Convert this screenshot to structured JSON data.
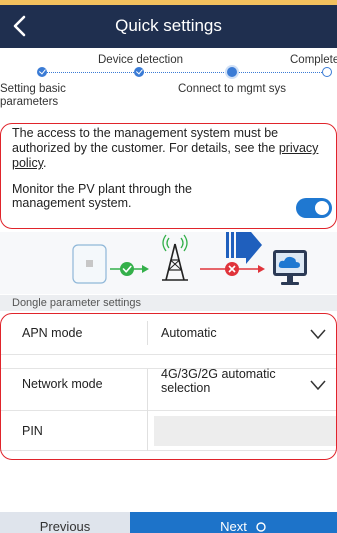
{
  "header": {
    "title": "Quick settings",
    "back_icon": "chevron-left-icon"
  },
  "stepper": {
    "steps": [
      {
        "label": "Setting basic parameters",
        "state": "done"
      },
      {
        "label": "Device detection",
        "state": "done"
      },
      {
        "label": "Connect to mgmt sys",
        "state": "current"
      },
      {
        "label": "Complete",
        "state": "pending"
      }
    ]
  },
  "consent": {
    "text": "The access to the management system must be authorized by the customer. For details, see the ",
    "link": "privacy policy",
    "suffix": "."
  },
  "monitor": {
    "label": "Monitor the PV plant through the management system.",
    "enabled": true
  },
  "diagram": {
    "icons": [
      "inverter-icon",
      "check-icon",
      "cell-tower-icon",
      "error-icon",
      "cloud-monitor-icon"
    ]
  },
  "dongle": {
    "section_title": "Dongle parameter settings",
    "apn_mode": {
      "label": "APN mode",
      "value": "Automatic"
    },
    "network_mode": {
      "label": "Network mode",
      "value": "4G/3G/2G automatic selection"
    },
    "pin": {
      "label": "PIN",
      "value": ""
    }
  },
  "footer": {
    "previous_label": "Previous",
    "next_label": "Next"
  },
  "colors": {
    "header": "#1f2f4f",
    "accent": "#1f78d1",
    "highlight": "#e0242b",
    "success": "#34b04a",
    "error": "#e0343b"
  }
}
